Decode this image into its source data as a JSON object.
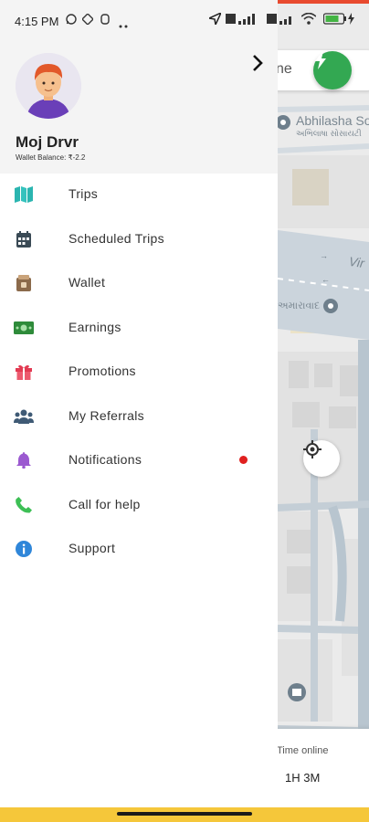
{
  "status_bar": {
    "time": "4:15 PM"
  },
  "profile": {
    "name": "Moj Drvr",
    "wallet_balance": "Wallet Balance: ₹-2.2"
  },
  "menu": [
    {
      "label": "Trips",
      "icon": "map-icon",
      "color": "#2bb5b0"
    },
    {
      "label": "Scheduled Trips",
      "icon": "calendar-icon",
      "color": "#3a4a55"
    },
    {
      "label": "Wallet",
      "icon": "wallet-icon",
      "color": "#8b6a4b"
    },
    {
      "label": "Earnings",
      "icon": "cash-icon",
      "color": "#2e8b3a"
    },
    {
      "label": "Promotions",
      "icon": "gift-icon",
      "color": "#e23a52"
    },
    {
      "label": "My Referrals",
      "icon": "users-icon",
      "color": "#3f5a75"
    },
    {
      "label": "Notifications",
      "icon": "bell-icon",
      "color": "#9b59d0",
      "has_badge": true
    },
    {
      "label": "Call for help",
      "icon": "phone-icon",
      "color": "#3dbf55"
    },
    {
      "label": "Support",
      "icon": "info-icon",
      "color": "#2f86d9"
    }
  ],
  "map": {
    "search_text": "ne",
    "place_name": "Abhilasha So",
    "place_subtitle": "અભિલાષા સોસાયટી",
    "poi_label": "અમારાવાદ",
    "road_label": "Vir"
  },
  "time_online": {
    "label": "Time online",
    "value": "1H 3M"
  },
  "colors": {
    "accent_green": "#33a852",
    "bottom_strip": "#f5c73a",
    "notification_dot": "#e0201f"
  }
}
